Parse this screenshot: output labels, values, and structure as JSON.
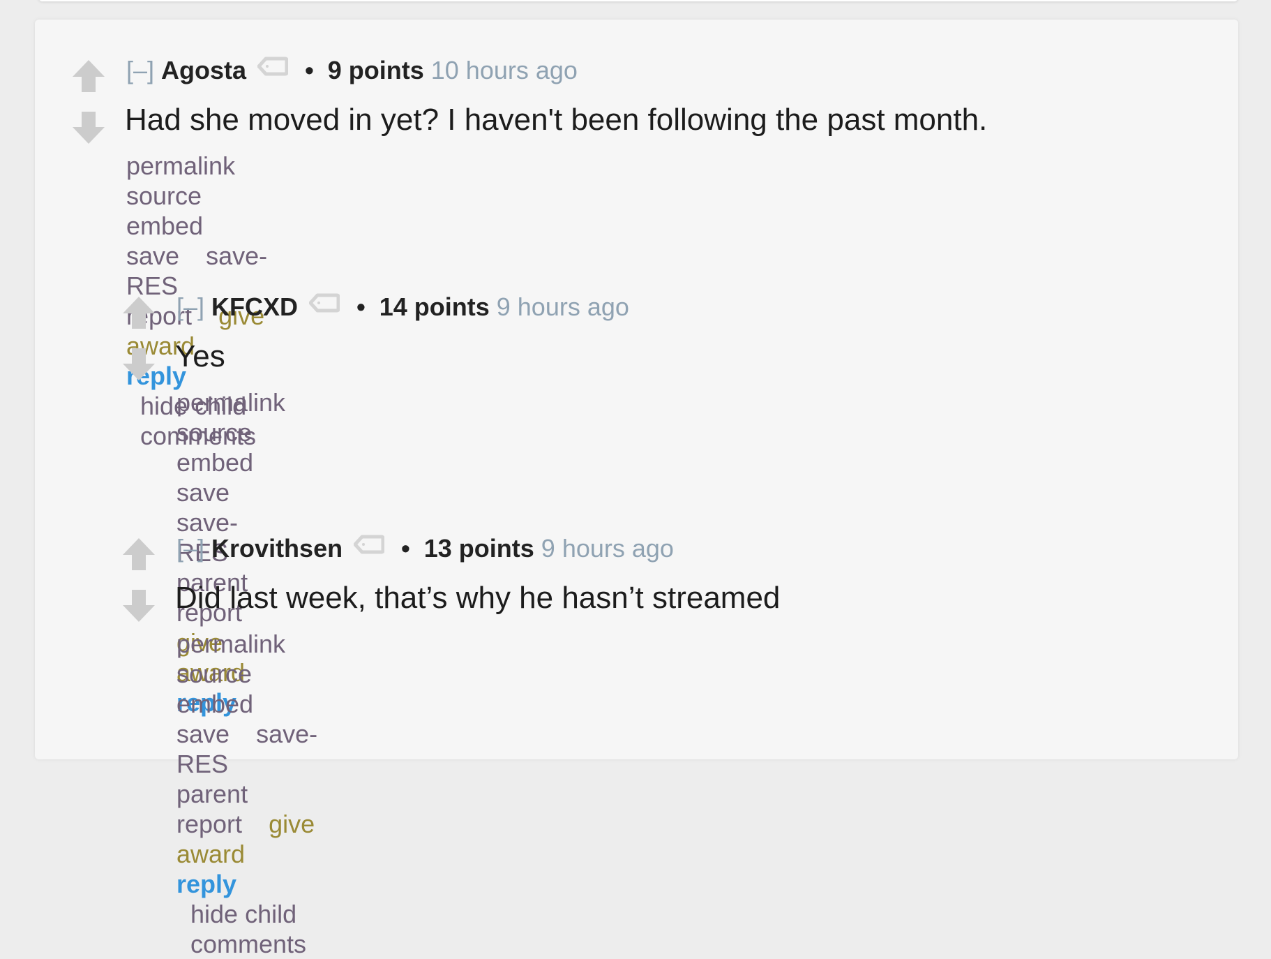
{
  "colors": {
    "page_background": "#ededed",
    "card_background": "#f6f6f6",
    "action_link": "#706279",
    "give_award": "#9a8a35",
    "reply": "#3394dc",
    "timestamp": "#8fa2b2",
    "vote_arrow": "#cccccc"
  },
  "comments": [
    {
      "collapse_label": "[–]",
      "author": "Agosta",
      "bullet": "•",
      "score": "9 points",
      "time": "10 hours ago",
      "body": "Had she moved in yet? I haven't been following the past month.",
      "actions": {
        "permalink": "permalink",
        "source": "source",
        "embed": "embed",
        "save": "save",
        "save_res": "save-RES",
        "report": "report",
        "give_award": "give award",
        "reply": "reply",
        "hide_child": "hide child comments"
      }
    },
    {
      "collapse_label": "[–]",
      "author": "KFCXD",
      "bullet": "•",
      "score": "14 points",
      "time": "9 hours ago",
      "body": "Yes",
      "actions": {
        "permalink": "permalink",
        "source": "source",
        "embed": "embed",
        "save": "save",
        "save_res": "save-RES",
        "parent": "parent",
        "report": "report",
        "give_award": "give award",
        "reply": "reply"
      }
    },
    {
      "collapse_label": "[–]",
      "author": "Krovithsen",
      "bullet": "•",
      "score": "13 points",
      "time": "9 hours ago",
      "body": "Did last week, that’s why he hasn’t streamed",
      "actions": {
        "permalink": "permalink",
        "source": "source",
        "embed": "embed",
        "save": "save",
        "save_res": "save-RES",
        "parent": "parent",
        "report": "report",
        "give_award": "give award",
        "reply": "reply",
        "hide_child": "hide child comments"
      }
    }
  ]
}
